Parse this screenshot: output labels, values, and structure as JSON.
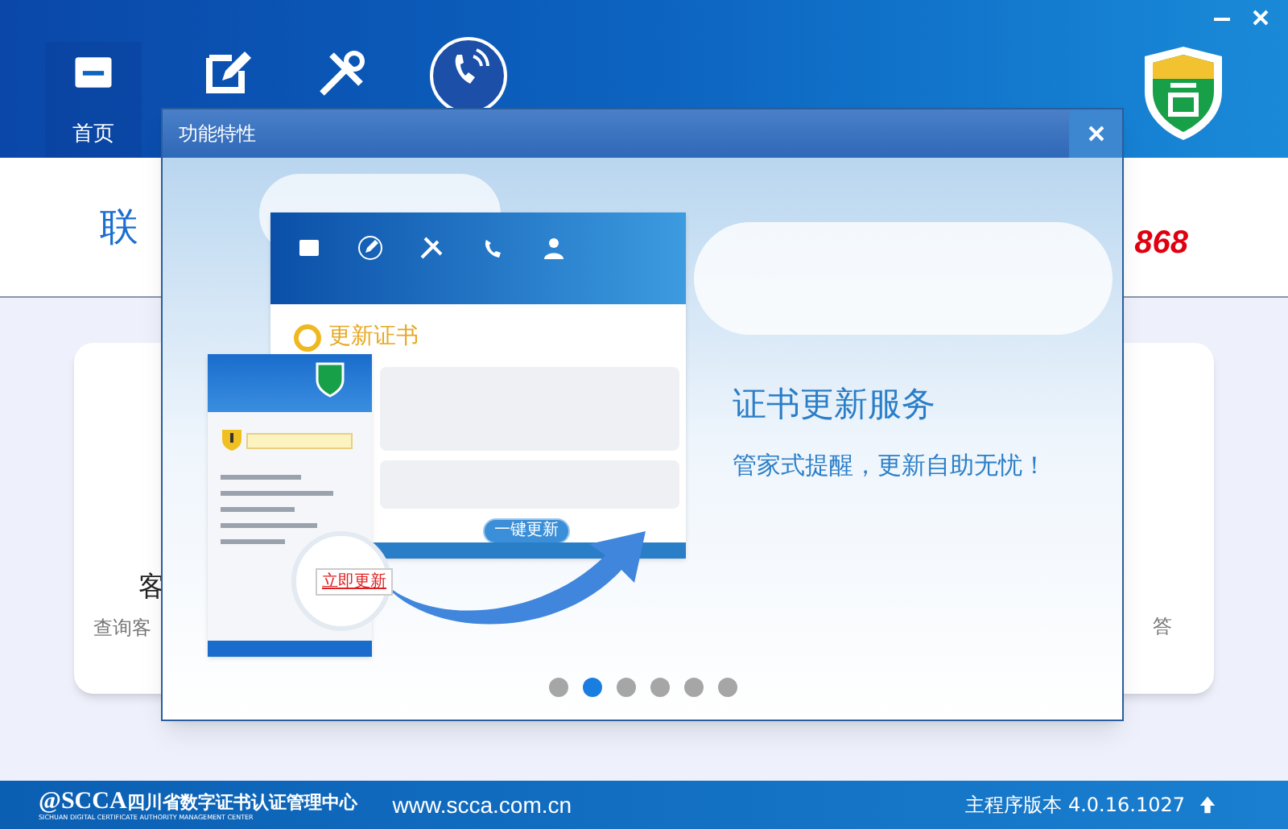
{
  "header": {
    "home_label": "首页"
  },
  "contact": {
    "title": "联",
    "phone": "868"
  },
  "cards": [
    {
      "title": "客",
      "subtitle": "查询客"
    },
    {
      "subtitle": "答"
    }
  ],
  "dialog": {
    "title": "功能特性",
    "slide": {
      "heading": "证书更新服务",
      "tagline": "管家式提醒，更新自助无忧！",
      "illustration": {
        "heading": "更新证书",
        "update_button": "一键更新",
        "popup_button": "立即更新"
      }
    },
    "pager": [
      {
        "selected": false
      },
      {
        "selected": true
      },
      {
        "selected": false
      },
      {
        "selected": false
      },
      {
        "selected": false
      },
      {
        "selected": false
      }
    ]
  },
  "footer": {
    "org_abbr": "@SCCA",
    "org_cn": "四川省数字证书认证管理中心",
    "org_en": "SICHUAN DIGITAL CERTIFICATE AUTHORITY MANAGEMENT CENTER",
    "url": "www.scca.com.cn",
    "version": "主程序版本 4.0.16.1027"
  }
}
